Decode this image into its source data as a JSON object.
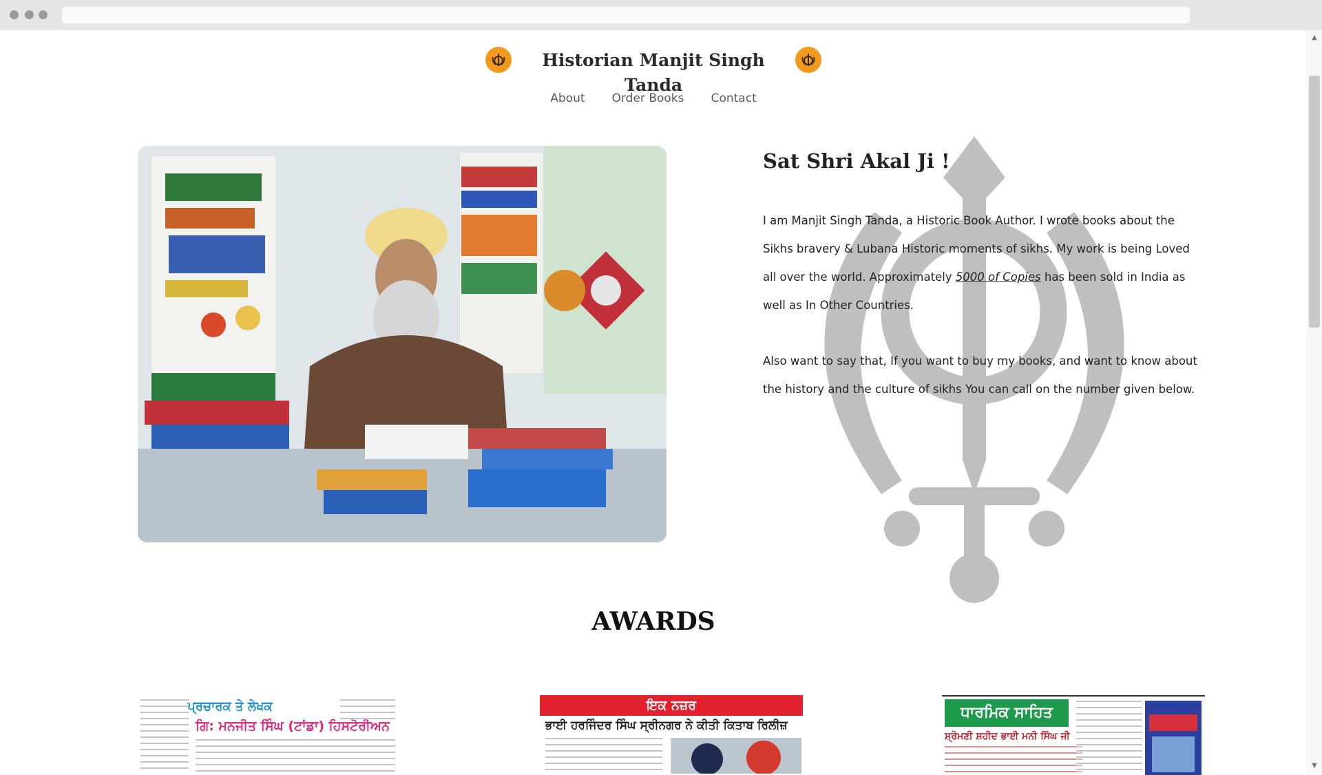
{
  "header": {
    "title": "Historian Manjit Singh Tanda",
    "left_icon": "khanda-badge-icon",
    "right_icon": "khanda-badge-icon",
    "icon_color": "#f39a1e"
  },
  "nav": {
    "items": [
      {
        "label": "About"
      },
      {
        "label": "Order Books"
      },
      {
        "label": "Contact"
      }
    ]
  },
  "hero": {
    "photo_alt": "Author seated at desk with books and awards",
    "greeting": "Sat Shri Akal Ji !",
    "para1_before": "I am Manjit Singh Tanda, a Historic Book Author. I wrote books about the Sikhs bravery & Lubana Historic moments of sikhs. My work is being Loved all over the world. Approximately ",
    "para1_highlight": "5000 of Copies",
    "para1_after": " has been sold in India as well as In Other Countries.",
    "para2": "Also want to say that, If you want to buy my books, and want to know about the history and the culture of sikhs You can call on the number given below.",
    "watermark_icon": "khanda-watermark-icon"
  },
  "awards": {
    "title": "AWARDS",
    "clippings": [
      {
        "headline_top": "ਪ੍ਰਚਾਰਕ ਤੇ ਲੇਖਕ",
        "headline_main": "ਗਿ: ਮਨਜੀਤ ਸਿੰਘ (ਟਾਂਡਾ) ਹਿਸਟੋਰੀਅਨ"
      },
      {
        "banner": "ਇਕ ਨਜ਼ਰ",
        "headline_main": "ਭਾਈ ਹਰਜਿੰਦਰ ਸਿੰਘ ਸ੍ਰੀਨਗਰ ਨੇ ਕੀਤੀ ਕਿਤਾਬ ਰਿਲੀਜ਼"
      },
      {
        "banner": "ਧਾਰਮਿਕ ਸਾਹਿਤ",
        "headline_main": "ਸ਼੍ਰੋਮਣੀ ਸ਼ਹੀਦ ਭਾਈ ਮਨੀ ਸਿੰਘ ਜੀ"
      }
    ]
  }
}
